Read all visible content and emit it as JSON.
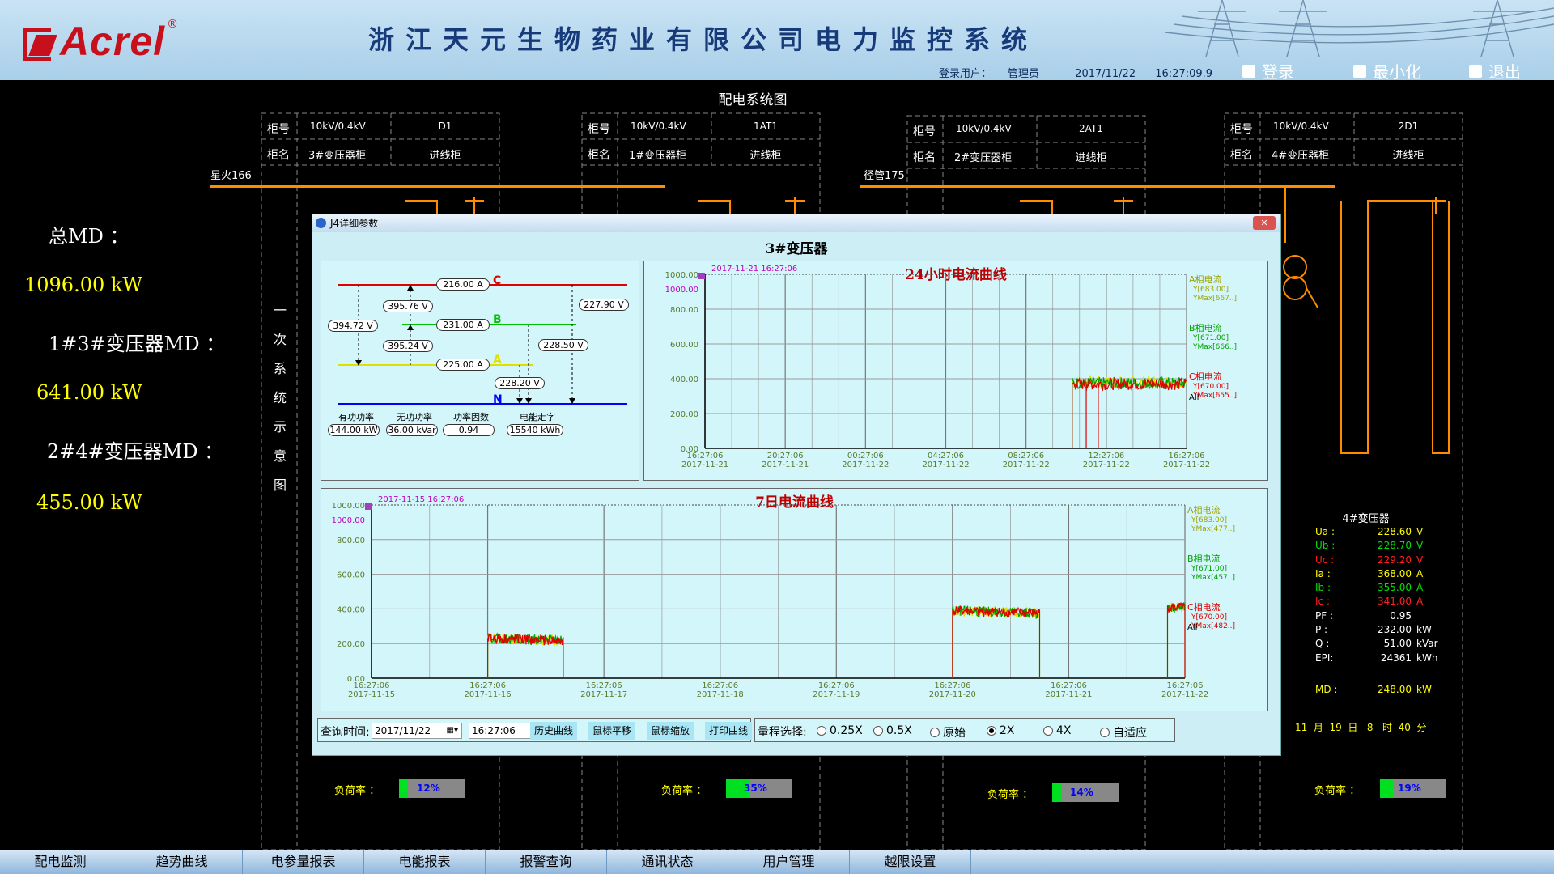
{
  "header": {
    "logo_text": "Acrel",
    "title": "浙江天元生物药业有限公司电力监控系统",
    "login_label": "登录用户：",
    "login_user": "管理员",
    "date": "2017/11/22",
    "time": "16:27:09.9",
    "login_button": "登录",
    "minimize_button": "最小化",
    "exit_button": "退出"
  },
  "diagram": {
    "title": "配电系统图",
    "busbar_left": "星火166",
    "busbar_right": "径管175",
    "vertical_label": [
      "一",
      "次",
      "系",
      "统",
      "示",
      "意",
      "图"
    ],
    "cabinets": [
      {
        "no_label": "柜号",
        "name_label": "柜名",
        "spec": "10kV/0.4kV",
        "no": "D1",
        "type": "3#变压器柜",
        "role": "进线柜"
      },
      {
        "no_label": "柜号",
        "name_label": "柜名",
        "spec": "10kV/0.4kV",
        "no": "1AT1",
        "type": "1#变压器柜",
        "role": "进线柜"
      },
      {
        "no_label": "柜号",
        "name_label": "柜名",
        "spec": "10kV/0.4kV",
        "no": "2AT1",
        "type": "2#变压器柜",
        "role": "进线柜"
      },
      {
        "no_label": "柜号",
        "name_label": "柜名",
        "spec": "10kV/0.4kV",
        "no": "2D1",
        "type": "4#变压器柜",
        "role": "进线柜"
      }
    ]
  },
  "md": {
    "total_label": "总MD ：",
    "total_value": "1096.00 kW",
    "g1_label": "1#3#变压器MD ：",
    "g1_value": "641.00 kW",
    "g2_label": "2#4#变压器MD ：",
    "g2_value": "455.00 kW"
  },
  "loads": [
    {
      "label": "负荷率 ：",
      "value": "12%",
      "pct": 12
    },
    {
      "label": "负荷率 ：",
      "value": "35%",
      "pct": 35
    },
    {
      "label": "负荷率 ：",
      "value": "14%",
      "pct": 14
    },
    {
      "label": "负荷率 ：",
      "value": "19%",
      "pct": 19
    }
  ],
  "transformer4": {
    "title": "4#变压器",
    "rows": [
      {
        "k": "Ua :",
        "v": "228.60",
        "u": "V",
        "color": "#ffff00"
      },
      {
        "k": "Ub :",
        "v": "228.70",
        "u": "V",
        "color": "#00e000"
      },
      {
        "k": "Uc :",
        "v": "229.20",
        "u": "V",
        "color": "#ff2020"
      },
      {
        "k": "Ia :",
        "v": "368.00",
        "u": "A",
        "color": "#ffff00"
      },
      {
        "k": "Ib :",
        "v": "355.00",
        "u": "A",
        "color": "#00e000"
      },
      {
        "k": "Ic :",
        "v": "341.00",
        "u": "A",
        "color": "#ff2020"
      },
      {
        "k": "PF :",
        "v": "0.95",
        "u": "",
        "color": "#ffffff"
      },
      {
        "k": "P  :",
        "v": "232.00",
        "u": "kW",
        "color": "#ffffff"
      },
      {
        "k": "Q  :",
        "v": "51.00",
        "u": "kVar",
        "color": "#ffffff"
      },
      {
        "k": "EPI:",
        "v": "24361",
        "u": "kWh",
        "color": "#ffffff"
      }
    ],
    "md_label": "MD :",
    "md_value": "248.00",
    "md_unit": "kW",
    "md_time": "11  月  19  日   8   时  40  分"
  },
  "nav": [
    "配电监测",
    "趋势曲线",
    "电参量报表",
    "电能报表",
    "报警查询",
    "通讯状态",
    "用户管理",
    "越限设置"
  ],
  "dialog": {
    "title": "J4详细参数",
    "close": "✕",
    "heading": "3#变压器",
    "phasor": {
      "phase_a": "A",
      "phase_b": "B",
      "phase_c": "C",
      "neutral": "N",
      "ic": "216.00 A",
      "ib": "231.00 A",
      "ia": "225.00 A",
      "uca": "394.72 V",
      "ubc": "395.76 V",
      "uab": "395.24 V",
      "uc": "227.90 V",
      "ub": "228.50 V",
      "ua": "228.20 V",
      "labels": [
        "有功功率",
        "无功功率",
        "功率因数",
        "电能走字"
      ],
      "values": [
        "144.00 kW",
        "36.00 kVar",
        "0.94",
        "15540 kWh"
      ]
    },
    "query": {
      "label": "查询时间:",
      "date": "2017/11/22",
      "time": "16:27:06",
      "buttons": [
        "历史曲线",
        "鼠标平移",
        "鼠标缩放",
        "打印曲线"
      ],
      "range_label": "量程选择:",
      "ranges": [
        "0.25X",
        "0.5X",
        "原始",
        "2X",
        "4X",
        "自适应"
      ],
      "selected": "2X"
    }
  },
  "chart_data": [
    {
      "type": "line",
      "title": "24小时电流曲线",
      "cursor": "2017-11-21  16:27:06",
      "ylim": [
        0,
        1000
      ],
      "yticks": [
        "1000.00",
        "800.00",
        "600.00",
        "400.00",
        "200.00",
        "0.00"
      ],
      "cursor_value": "1000.00",
      "xticks": [
        [
          "16:27:06",
          "2017-11-21"
        ],
        [
          "20:27:06",
          "2017-11-21"
        ],
        [
          "00:27:06",
          "2017-11-22"
        ],
        [
          "04:27:06",
          "2017-11-22"
        ],
        [
          "08:27:06",
          "2017-11-22"
        ],
        [
          "12:27:06",
          "2017-11-22"
        ],
        [
          "16:27:06",
          "2017-11-22"
        ]
      ],
      "x": [
        0,
        4,
        8,
        12,
        16,
        20,
        24
      ],
      "series": [
        {
          "name": "A相电流",
          "color": "#e0e000",
          "y_text": "Y[683.00]",
          "ymax_text": "YMax[667..]",
          "values": [
            0,
            0,
            0,
            0,
            0,
            380,
            380
          ]
        },
        {
          "name": "B相电流",
          "color": "#00a000",
          "y_text": "Y[671.00]",
          "ymax_text": "YMax[666..]",
          "values": [
            0,
            0,
            0,
            0,
            0,
            375,
            375
          ]
        },
        {
          "name": "C相电流",
          "color": "#e00000",
          "y_text": "Y[670.00]",
          "ymax_text": "YMax[655..]",
          "values": [
            0,
            0,
            0,
            0,
            0,
            370,
            370
          ]
        }
      ],
      "all_label": "All"
    },
    {
      "type": "line",
      "title": "7日电流曲线",
      "cursor": "2017-11-15  16:27:06",
      "ylim": [
        0,
        1000
      ],
      "yticks": [
        "1000.00",
        "800.00",
        "600.00",
        "400.00",
        "200.00",
        "0.00"
      ],
      "cursor_value": "1000.00",
      "xticks": [
        [
          "16:27:06",
          "2017-11-15"
        ],
        [
          "16:27:06",
          "2017-11-16"
        ],
        [
          "16:27:06",
          "2017-11-17"
        ],
        [
          "16:27:06",
          "2017-11-18"
        ],
        [
          "16:27:06",
          "2017-11-19"
        ],
        [
          "16:27:06",
          "2017-11-20"
        ],
        [
          "16:27:06",
          "2017-11-21"
        ],
        [
          "16:27:06",
          "2017-11-22"
        ]
      ],
      "series": [
        {
          "name": "A相电流",
          "color": "#e0e000",
          "y_text": "Y[683.00]",
          "ymax_text": "YMax[477..]"
        },
        {
          "name": "B相电流",
          "color": "#00a000",
          "y_text": "Y[671.00]",
          "ymax_text": "YMax[457..]"
        },
        {
          "name": "C相电流",
          "color": "#e00000",
          "y_text": "Y[670.00]",
          "ymax_text": "YMax[482..]"
        }
      ],
      "segments": [
        {
          "from_day": 1.0,
          "to_day": 1.65,
          "level": 230
        },
        {
          "from_day": 5.0,
          "to_day": 5.75,
          "level": 390
        },
        {
          "from_day": 6.85,
          "to_day": 7.0,
          "level": 410
        }
      ],
      "all_label": "All"
    }
  ]
}
